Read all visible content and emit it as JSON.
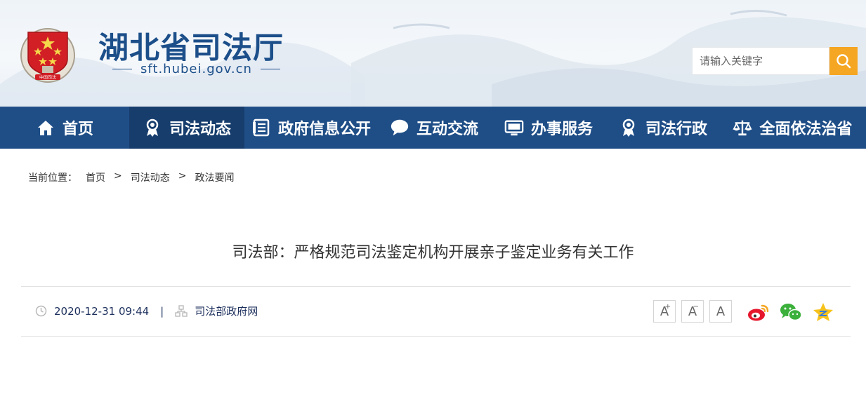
{
  "header": {
    "title": "湖北省司法厅",
    "url": "sft.hubei.gov.cn",
    "emblem_label": "中国司法",
    "search_placeholder": "请输入关键字"
  },
  "nav": {
    "items": [
      {
        "label": "首页",
        "icon": "home-icon"
      },
      {
        "label": "司法动态",
        "icon": "badge-icon",
        "active": true
      },
      {
        "label": "政府信息公开",
        "icon": "document-icon"
      },
      {
        "label": "互动交流",
        "icon": "chat-bubble-icon"
      },
      {
        "label": "办事服务",
        "icon": "monitor-icon"
      },
      {
        "label": "司法行政",
        "icon": "badge-icon"
      },
      {
        "label": "全面依法治省",
        "icon": "scales-icon"
      }
    ]
  },
  "breadcrumb": {
    "prefix": "当前位置：",
    "items": [
      "首页",
      "司法动态",
      "政法要闻"
    ],
    "separator": ">"
  },
  "article": {
    "title": "司法部：严格规范司法鉴定机构开展亲子鉴定业务有关工作",
    "datetime": "2020-12-31 09:44",
    "divider": "|",
    "source": "司法部政府网"
  },
  "font_controls": {
    "increase": "A",
    "decrease": "A",
    "reset": "A",
    "increase_mark": "+",
    "decrease_mark": "−"
  },
  "share": [
    "weibo-icon",
    "wechat-icon",
    "qzone-icon"
  ],
  "colors": {
    "nav_bg": "#1f4e87",
    "nav_active": "#163d6c",
    "title_blue": "#1c4f8a",
    "search_btn": "#f5a623"
  }
}
